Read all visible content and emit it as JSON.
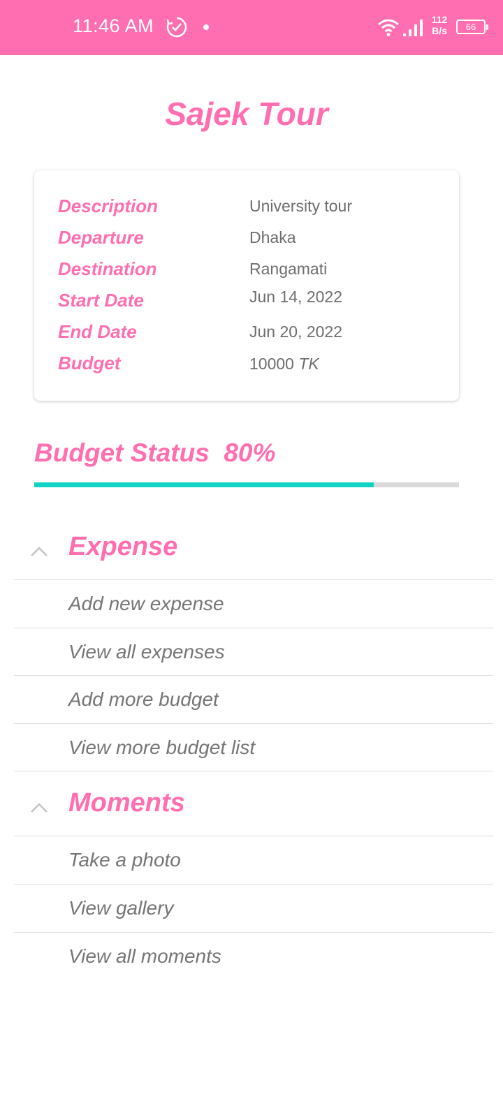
{
  "status_bar": {
    "time": "11:46 AM",
    "net_speed_value": "112",
    "net_speed_unit": "B/s",
    "battery_level": "66",
    "icons": [
      "clock-check-icon",
      "dot-icon",
      "wifi-icon",
      "signal-icon",
      "battery-icon"
    ]
  },
  "page": {
    "title": "Sajek Tour"
  },
  "details": {
    "description_label": "Description",
    "description_value": "University tour",
    "departure_label": "Departure",
    "departure_value": "Dhaka",
    "destination_label": "Destination",
    "destination_value": "Rangamati",
    "start_date_label": "Start Date",
    "start_date_value": "Jun 14, 2022",
    "end_date_label": "End Date",
    "end_date_value": "Jun 20, 2022",
    "budget_label": "Budget",
    "budget_value": "10000",
    "budget_unit": "TK"
  },
  "budget_status": {
    "label": "Budget Status",
    "percent_text": "80%",
    "progress_fraction": 0.8
  },
  "expense_section": {
    "title": "Expense",
    "items": [
      "Add new expense",
      "View all expenses",
      "Add more budget",
      "View more budget list"
    ]
  },
  "moments_section": {
    "title": "Moments",
    "items": [
      "Take a photo",
      "View gallery",
      "View all moments"
    ]
  },
  "colors": {
    "accent": "#ff6eb0",
    "progress": "#10d3c3",
    "text_muted": "#757575"
  }
}
